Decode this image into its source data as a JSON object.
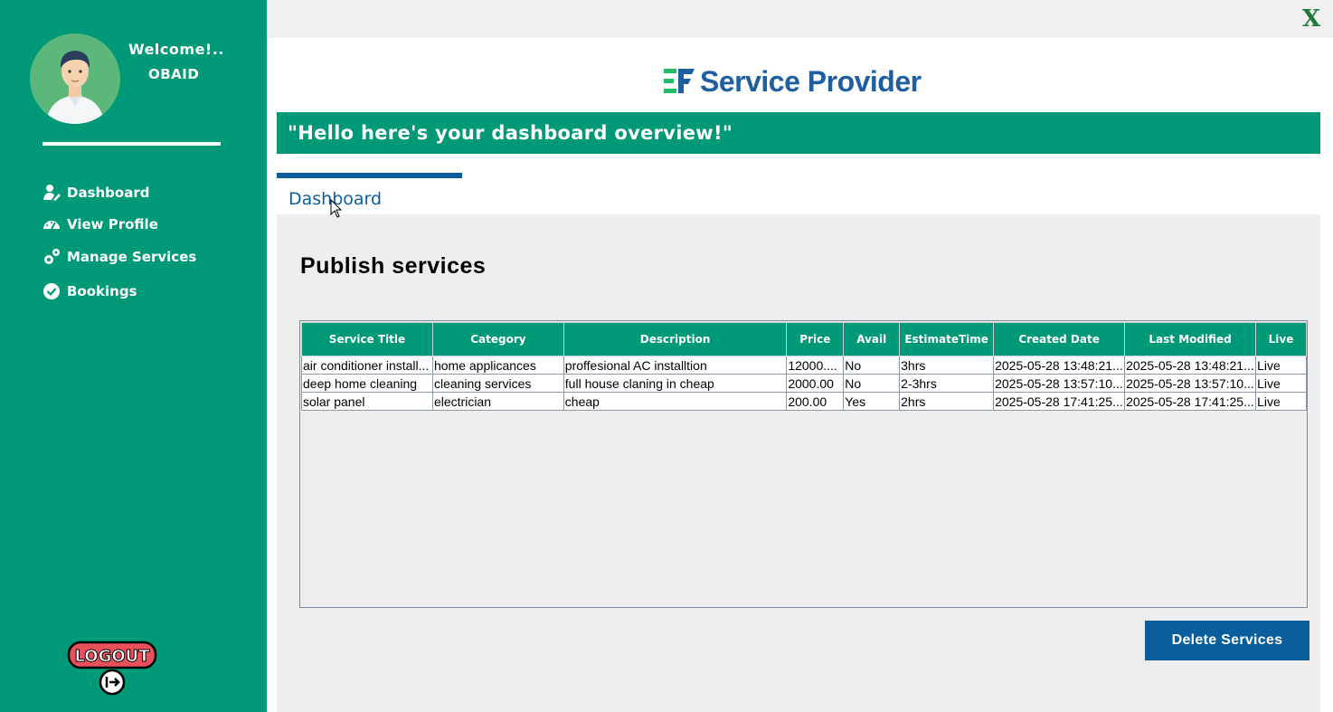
{
  "sidebar": {
    "welcome": "Welcome!..",
    "username": "OBAID",
    "nav": [
      {
        "label": "Dashboard",
        "icon": "user-edit-icon"
      },
      {
        "label": "View Profile",
        "icon": "gauge-icon"
      },
      {
        "label": "Manage Services",
        "icon": "gears-icon"
      },
      {
        "label": "Bookings",
        "icon": "check-circle-icon"
      }
    ],
    "logout_label": "LOGOUT"
  },
  "window": {
    "close_label": "X"
  },
  "header": {
    "logo_text": "Service Provider",
    "banner": "\"Hello here's your dashboard overview!\""
  },
  "tab": {
    "label": "Dashboard"
  },
  "main": {
    "title": "Publish services",
    "table": {
      "columns": [
        "Service Title",
        "Category",
        "Description",
        "Price",
        "Avail",
        "EstimateTime",
        "Created Date",
        "Last Modified",
        "Live"
      ],
      "rows": [
        [
          "air conditioner install...",
          "home applicances",
          "proffesional AC installtion",
          "12000....",
          "No",
          "3hrs",
          "2025-05-28 13:48:21...",
          "2025-05-28 13:48:21...",
          "Live"
        ],
        [
          "deep home cleaning",
          "cleaning services",
          "full house claning in cheap",
          "2000.00",
          "No",
          "2-3hrs",
          "2025-05-28 13:57:10...",
          "2025-05-28 13:57:10...",
          "Live"
        ],
        [
          "solar panel",
          "electrician",
          "cheap",
          "200.00",
          "Yes",
          "2hrs",
          "2025-05-28 17:41:25...",
          "2025-05-28 17:41:25...",
          "Live"
        ]
      ]
    },
    "delete_button": "Delete Services"
  },
  "colors": {
    "brand_green": "#009977",
    "brand_blue": "#0b5e9c",
    "logout_red": "#e8505b"
  }
}
